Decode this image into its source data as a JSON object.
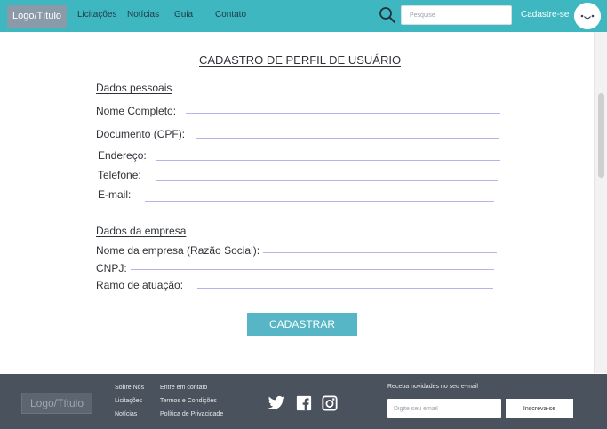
{
  "header": {
    "logo": "Logo/Título",
    "nav": [
      "Licitações",
      "Notícias",
      "Guia",
      "Contato"
    ],
    "search_placeholder": "Pesquise",
    "signup": "Cadastre-se"
  },
  "form": {
    "title": "CADASTRO DE PERFIL DE USUÁRIO",
    "personal_section": "Dados pessoais",
    "personal_fields": [
      "Nome Completo:",
      "Documento (CPF):",
      "Endereço:",
      "Telefone:",
      "E-mail:"
    ],
    "company_section": "Dados da empresa",
    "company_fields": [
      "Nome da empresa (Razão Social):",
      "CNPJ:",
      "Ramo de atuação:"
    ],
    "submit": "CADASTRAR"
  },
  "footer": {
    "logo": "Logo/Título",
    "col1": [
      "Sobre Nós",
      "Licitações",
      "Notícias"
    ],
    "col2": [
      "Entre em contato",
      "Termos e Condições",
      "Política de Privacidade"
    ],
    "social_icons": [
      "twitter-icon",
      "facebook-icon",
      "instagram-icon"
    ],
    "newsletter_text": "Receba novidades no seu e-mail",
    "email_placeholder": "Digite seu email",
    "subscribe": "Inscreva-se"
  },
  "colors": {
    "header_bg": "#3fb7c1",
    "footer_bg": "#4a525d",
    "button_bg": "#56b6c6",
    "field_line": "#b3b4ea"
  }
}
